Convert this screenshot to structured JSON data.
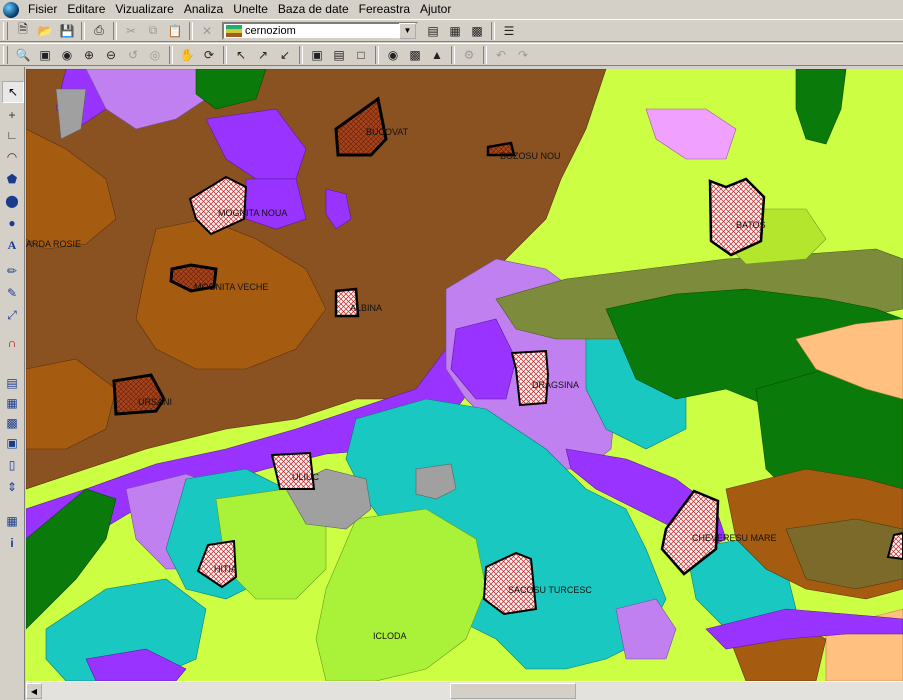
{
  "menu": {
    "items": [
      {
        "label": "Fisier"
      },
      {
        "label": "Editare"
      },
      {
        "label": "Vizualizare"
      },
      {
        "label": "Analiza"
      },
      {
        "label": "Unelte"
      },
      {
        "label": "Baza de date"
      },
      {
        "label": "Fereastra"
      },
      {
        "label": "Ajutor"
      }
    ]
  },
  "toolbar": {
    "layer_value": "cernoziom"
  },
  "map": {
    "labels": {
      "bucovat": "BUCOVAT",
      "bozosu_nou": "BOZOSU NOU",
      "mogosita_noua": "MOGNITA NOUA",
      "barda_rosie": "ARDA ROSIE",
      "mogosita_veche": "MOGNITA VECHE",
      "albina": "ALBINA",
      "ursani": "URSANI",
      "batos": "BATOS",
      "dragsina": "DRAGSINA",
      "uliuc": "ULIUC",
      "chevere_mare": "CHEVERESU MARE",
      "hitias": "HITIA",
      "sacosu_turcesc": "SACOSU TURCESC",
      "icloda": "ICLODA"
    }
  },
  "colors": {
    "brown_dark": "#8a5221",
    "brown_mid": "#a65c10",
    "purple": "#9933ff",
    "lavender": "#c080f0",
    "lime": "#ccff44",
    "yellow_green": "#aaf23a",
    "teal": "#19c8c0",
    "dark_green": "#0a7a0a",
    "olive": "#7c8c3c",
    "grey": "#a0a0a0",
    "peach": "#ffc080"
  }
}
